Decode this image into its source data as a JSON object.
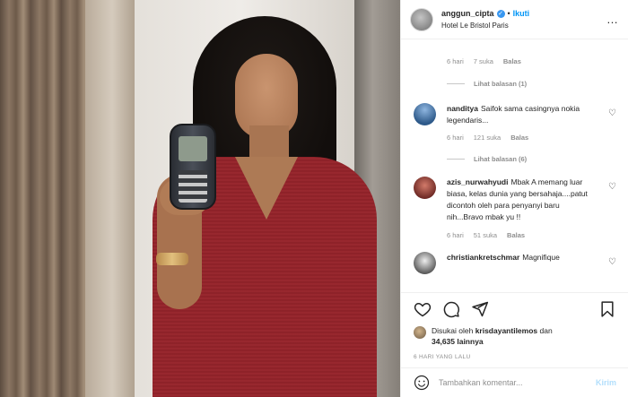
{
  "post": {
    "username": "anggun_cipta",
    "follow_label": "Ikuti",
    "dot": "•",
    "location": "Hotel Le Bristol Paris",
    "more_icon": "…"
  },
  "comments": [
    {
      "meta": {
        "time": "6 hari",
        "likes": "7 suka",
        "reply": "Balas"
      },
      "view_replies": "Lihat balasan (1)"
    },
    {
      "username": "nanditya",
      "text": "Saifok sama casingnya nokia legendaris...",
      "meta": {
        "time": "6 hari",
        "likes": "121 suka",
        "reply": "Balas"
      },
      "view_replies": "Lihat balasan (6)"
    },
    {
      "username": "azis_nurwahyudi",
      "text": "Mbak A memang luar biasa, kelas dunia yang bersahaja....patut dicontoh oleh para penyanyi baru nih...Bravo mbak yu !!",
      "meta": {
        "time": "6 hari",
        "likes": "51 suka",
        "reply": "Balas"
      }
    },
    {
      "username": "christiankretschmar",
      "text": "Magnifique"
    }
  ],
  "likes": {
    "prefix": "Disukai oleh",
    "liker": "krisdayantilemos",
    "conj": "dan",
    "others": "34,635 lainnya"
  },
  "time_ago": "6 HARI YANG LALU",
  "add_comment": {
    "placeholder": "Tambahkan komentar...",
    "send_label": "Kirim"
  },
  "colors": {
    "accent": "#0095f6",
    "verified": "#3897f0",
    "muted": "#8e8e8e",
    "send_disabled": "#b2dffc"
  },
  "icons": [
    "heart-icon",
    "comment-icon",
    "share-icon",
    "bookmark-icon",
    "emoji-icon",
    "verified-icon",
    "more-icon"
  ]
}
